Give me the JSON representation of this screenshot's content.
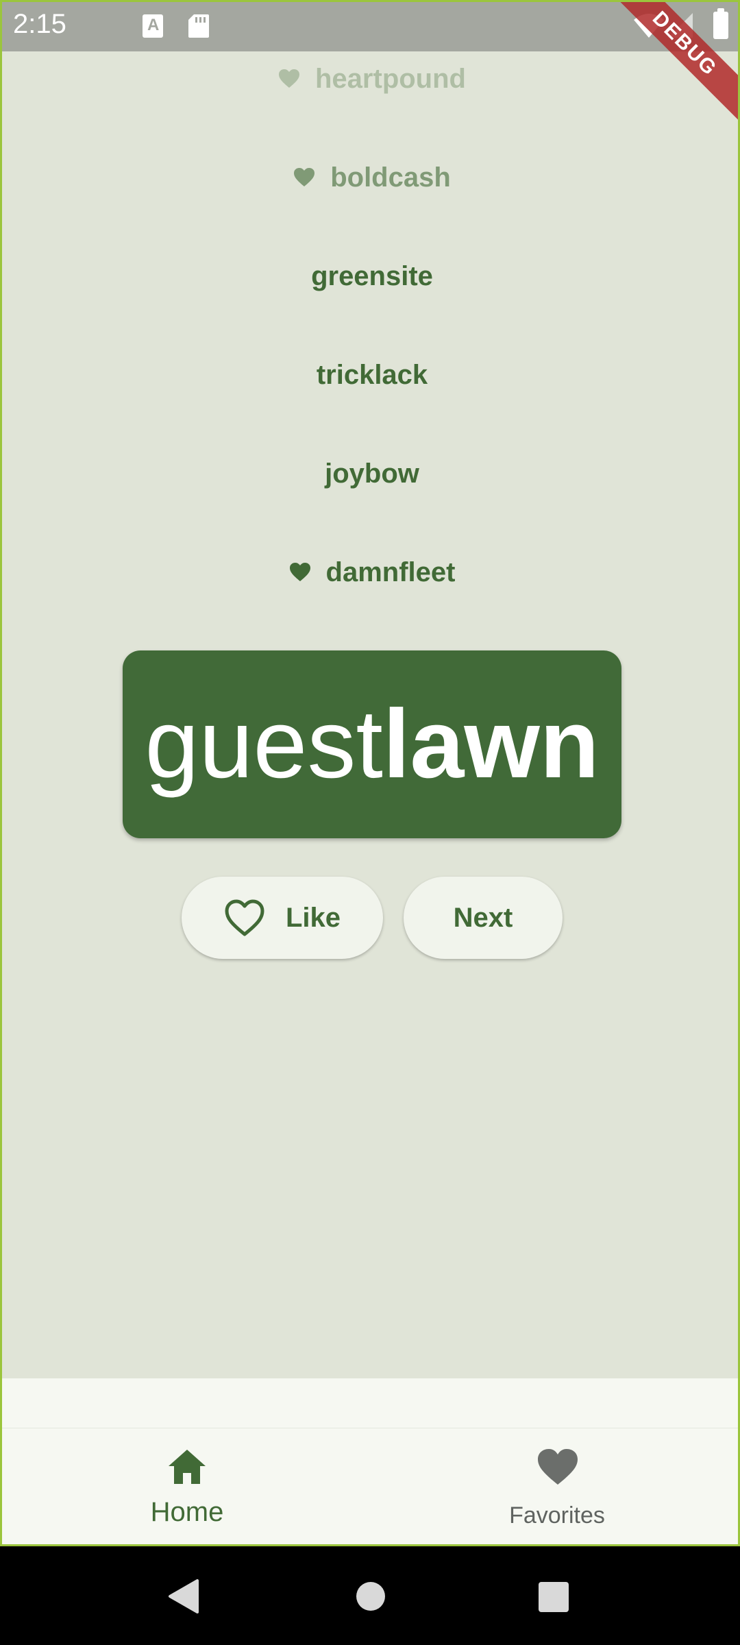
{
  "status_bar": {
    "time": "2:15",
    "keyboard_icon_letter": "A"
  },
  "debug_banner": "DEBUG",
  "history": [
    {
      "word": "heartpound",
      "favorite": true,
      "opacity": 0.3
    },
    {
      "word": "boldcash",
      "favorite": true,
      "opacity": 0.6
    },
    {
      "word": "greensite",
      "favorite": false,
      "opacity": 1.0
    },
    {
      "word": "tricklack",
      "favorite": false,
      "opacity": 1.0
    },
    {
      "word": "joybow",
      "favorite": false,
      "opacity": 1.0
    },
    {
      "word": "damnfleet",
      "favorite": true,
      "opacity": 1.0
    }
  ],
  "current_pair": {
    "first": "guest",
    "second": "lawn"
  },
  "actions": {
    "like_label": "Like",
    "next_label": "Next"
  },
  "bottom_nav": {
    "home_label": "Home",
    "favorites_label": "Favorites",
    "selected": "home"
  },
  "colors": {
    "primary": "#416a38",
    "background": "#e0e4d7",
    "button_surface": "#f1f4ec",
    "nav_surface": "#f6f8f2",
    "unselected_icon": "#6b6e6b"
  }
}
